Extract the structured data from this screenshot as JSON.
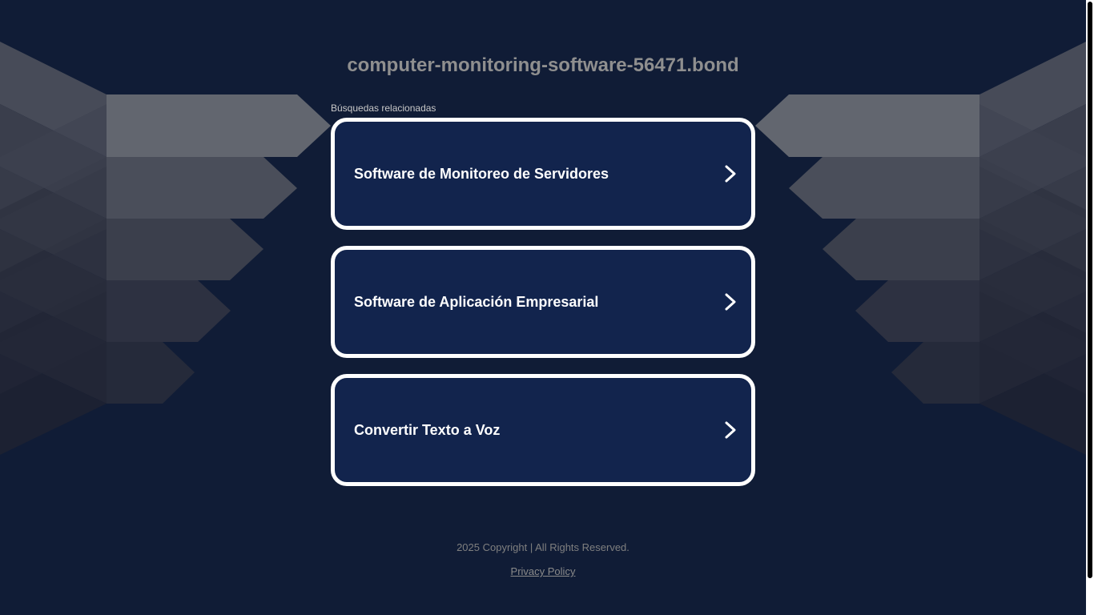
{
  "site": {
    "title": "computer-monitoring-software-56471.bond"
  },
  "related": {
    "label": "Búsquedas relacionadas",
    "items": [
      {
        "label": "Software de Monitoreo de Servidores",
        "icon": "chevron-right-icon"
      },
      {
        "label": "Software de Aplicación Empresarial",
        "icon": "chevron-right-icon"
      },
      {
        "label": "Convertir Texto a Voz",
        "icon": "chevron-right-icon"
      }
    ]
  },
  "footer": {
    "copyright": "2025 Copyright | All Rights Reserved.",
    "privacy_label": "Privacy Policy"
  },
  "colors": {
    "background": "#101c36",
    "card_background": "#12244d",
    "card_border": "#ffffff",
    "title_text": "#8f8f8f"
  }
}
